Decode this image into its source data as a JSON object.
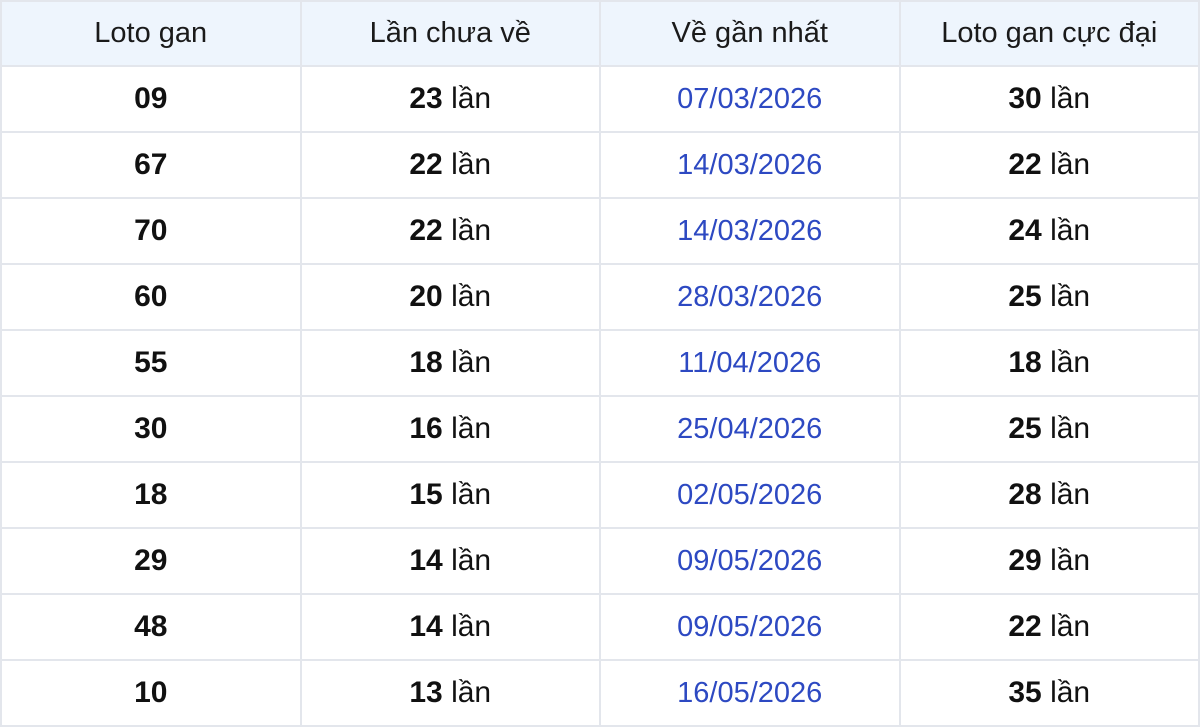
{
  "table": {
    "headers": [
      "Loto gan",
      "Lần chưa về",
      "Về gần nhất",
      "Loto gan cực đại"
    ],
    "unit": "lần",
    "rows": [
      {
        "number": "09",
        "missed": "23",
        "last_seen": "07/03/2026",
        "max_gap": "30"
      },
      {
        "number": "67",
        "missed": "22",
        "last_seen": "14/03/2026",
        "max_gap": "22"
      },
      {
        "number": "70",
        "missed": "22",
        "last_seen": "14/03/2026",
        "max_gap": "24"
      },
      {
        "number": "60",
        "missed": "20",
        "last_seen": "28/03/2026",
        "max_gap": "25"
      },
      {
        "number": "55",
        "missed": "18",
        "last_seen": "11/04/2026",
        "max_gap": "18"
      },
      {
        "number": "30",
        "missed": "16",
        "last_seen": "25/04/2026",
        "max_gap": "25"
      },
      {
        "number": "18",
        "missed": "15",
        "last_seen": "02/05/2026",
        "max_gap": "28"
      },
      {
        "number": "29",
        "missed": "14",
        "last_seen": "09/05/2026",
        "max_gap": "29"
      },
      {
        "number": "48",
        "missed": "14",
        "last_seen": "09/05/2026",
        "max_gap": "22"
      },
      {
        "number": "10",
        "missed": "13",
        "last_seen": "16/05/2026",
        "max_gap": "35"
      }
    ]
  },
  "colors": {
    "header_bg": "#eef5fd",
    "date_text": "#2d49c2",
    "border": "#e3e6ec"
  }
}
